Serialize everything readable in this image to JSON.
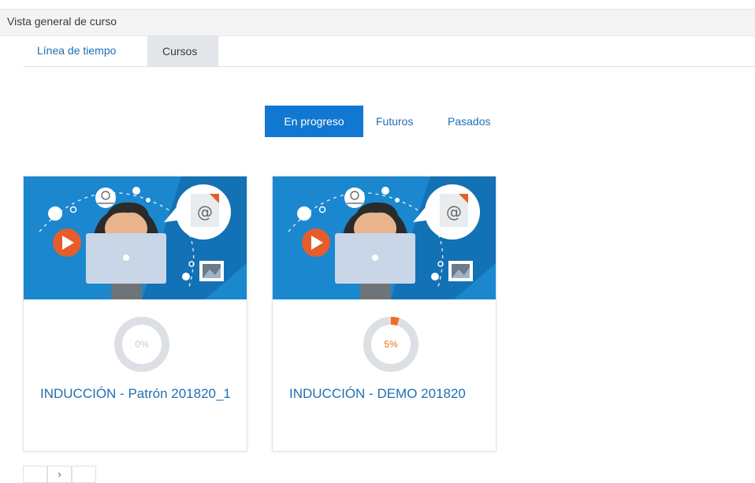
{
  "header": {
    "title": "Vista general de curso"
  },
  "tabs": [
    {
      "label": "Línea de tiempo",
      "active": false
    },
    {
      "label": "Cursos",
      "active": true
    }
  ],
  "filters": [
    {
      "label": "En progreso",
      "active": true
    },
    {
      "label": "Futuros",
      "active": false
    },
    {
      "label": "Pasados",
      "active": false
    }
  ],
  "courses": [
    {
      "name": "INDUCCIÓN - Patrón 201820_1",
      "progress": 0,
      "progress_label": "0%"
    },
    {
      "name": "INDUCCIÓN - DEMO 201820",
      "progress": 0.05,
      "progress_label": "5%"
    }
  ],
  "pagination": {
    "prev_icon": "chevron-left-icon",
    "next_icon": "chevron-right-icon",
    "next_glyph": "›"
  },
  "colors": {
    "primary": "#1177d1",
    "link": "#1f6fb2",
    "progress_fill": "#f26b21",
    "progress_track": "#dcdfe3",
    "banner_blue": "#1a87cf"
  }
}
